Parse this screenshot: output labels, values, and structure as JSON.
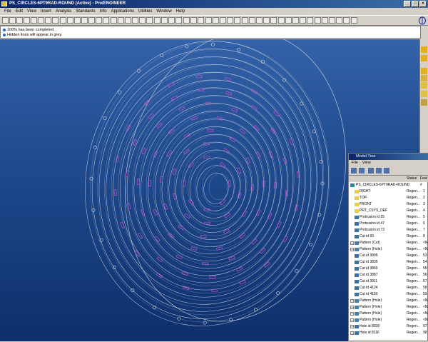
{
  "window": {
    "title": "PS_CIRCLES-6PT9RAD-ROUND (Active) - Pro/ENGINEER"
  },
  "menu": [
    "File",
    "Edit",
    "View",
    "Insert",
    "Analysis",
    "Standards",
    "Info",
    "Applications",
    "Utilities",
    "Window",
    "Help"
  ],
  "messages": [
    "100% has been completed.",
    "Hidden lines will appear in grey."
  ],
  "colors": {
    "accent": "#0a246a",
    "viewport_top": "#3462a8",
    "viewport_bottom": "#0e2f6c",
    "wire": "#d8dbe4",
    "pattern": "#c050c8"
  },
  "model_tree": {
    "title": "Model Tree",
    "menu": [
      "File",
      "View"
    ],
    "columns": {
      "status": "Status",
      "feat": "Feat #"
    },
    "rows": [
      {
        "name": "PS_CIRCLES-6PT9RAD-ROUND",
        "status": "",
        "num": "",
        "icon": "part-icon",
        "expand": ""
      },
      {
        "name": "RIGHT",
        "status": "Regen...",
        "num": "1",
        "icon": "datum-plane-icon",
        "expand": ""
      },
      {
        "name": "TOP",
        "status": "Regen...",
        "num": "2",
        "icon": "datum-plane-icon",
        "expand": ""
      },
      {
        "name": "FRONT",
        "status": "Regen...",
        "num": "3",
        "icon": "datum-plane-icon",
        "expand": ""
      },
      {
        "name": "PRT_CSYS_DEF",
        "status": "Regen...",
        "num": "4",
        "icon": "csys-icon",
        "expand": ""
      },
      {
        "name": "Protrusion id 25",
        "status": "Regen...",
        "num": "5",
        "icon": "feature-icon",
        "expand": ""
      },
      {
        "name": "Protrusion id 47",
        "status": "Regen...",
        "num": "6",
        "icon": "feature-icon",
        "expand": ""
      },
      {
        "name": "Protrusion id 73",
        "status": "Regen...",
        "num": "7",
        "icon": "feature-icon",
        "expand": ""
      },
      {
        "name": "Cut id 93",
        "status": "Regen...",
        "num": "8",
        "icon": "feature-icon",
        "expand": ""
      },
      {
        "name": "Pattern (Cut)",
        "status": "Regen...",
        "num": "<Non",
        "icon": "pattern-icon",
        "expand": "+"
      },
      {
        "name": "Pattern (Hole)",
        "status": "Regen...",
        "num": "<Non",
        "icon": "pattern-icon",
        "expand": "+"
      },
      {
        "name": "Cut id 3805",
        "status": "Regen...",
        "num": "53",
        "icon": "feature-icon",
        "expand": ""
      },
      {
        "name": "Cut id 3835",
        "status": "Regen...",
        "num": "54",
        "icon": "feature-icon",
        "expand": ""
      },
      {
        "name": "Cut id 3865",
        "status": "Regen...",
        "num": "55",
        "icon": "feature-icon",
        "expand": ""
      },
      {
        "name": "Cut id 3887",
        "status": "Regen...",
        "num": "56",
        "icon": "feature-icon",
        "expand": ""
      },
      {
        "name": "Cut id 3911",
        "status": "Regen...",
        "num": "57",
        "icon": "feature-icon",
        "expand": ""
      },
      {
        "name": "Cut id 4124",
        "status": "Regen...",
        "num": "58",
        "icon": "feature-icon",
        "expand": ""
      },
      {
        "name": "Cut id 4150",
        "status": "Regen...",
        "num": "59",
        "icon": "feature-icon",
        "expand": ""
      },
      {
        "name": "Pattern (Hole)",
        "status": "Regen...",
        "num": "<Non",
        "icon": "pattern-icon",
        "expand": "+"
      },
      {
        "name": "Pattern (Hole)",
        "status": "Regen...",
        "num": "<Non",
        "icon": "pattern-icon",
        "expand": "+"
      },
      {
        "name": "Pattern (Hole)",
        "status": "Regen...",
        "num": "<Non",
        "icon": "pattern-icon",
        "expand": "+"
      },
      {
        "name": "Pattern (Hole)",
        "status": "Regen...",
        "num": "<Non",
        "icon": "pattern-icon",
        "expand": "+"
      },
      {
        "name": "Hole id 8028",
        "status": "Regen...",
        "num": "97",
        "icon": "hole-icon",
        "expand": "+"
      },
      {
        "name": "Hole id 8116",
        "status": "Regen...",
        "num": "98",
        "icon": "hole-icon",
        "expand": "+"
      }
    ]
  }
}
